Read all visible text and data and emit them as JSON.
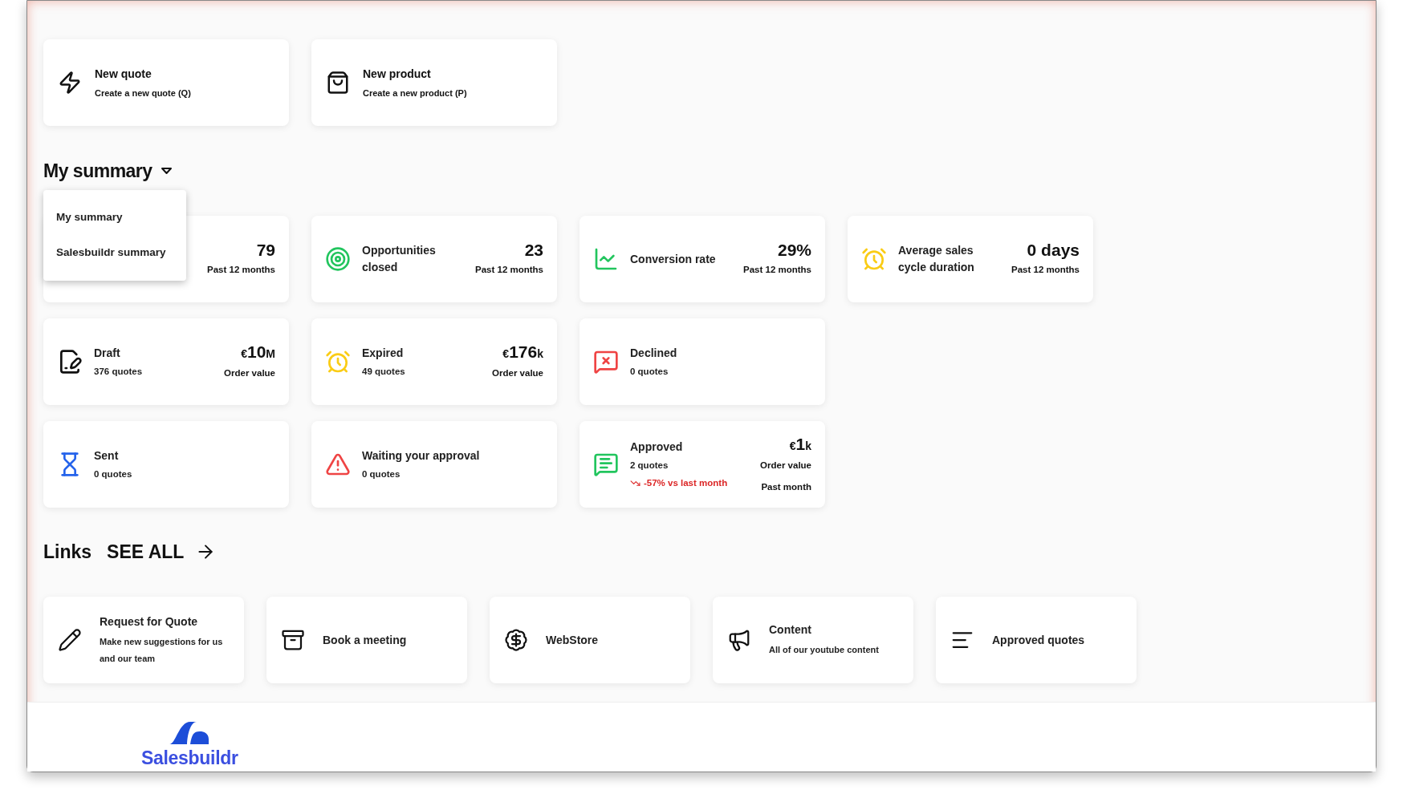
{
  "quick_actions": [
    {
      "title": "New quote",
      "subtitle": "Create a new quote (Q)"
    },
    {
      "title": "New product",
      "subtitle": "Create a new product (P)"
    }
  ],
  "summary": {
    "title": "My summary",
    "menu": [
      "My summary",
      "Salesbuildr summary"
    ]
  },
  "stats_rows": [
    [
      {
        "value": "79",
        "caption": "Past 12 months"
      },
      {
        "title": "Opportunities closed",
        "value": "23",
        "caption": "Past 12 months"
      },
      {
        "title": "Conversion rate",
        "value": "29%",
        "caption": "Past 12 months"
      },
      {
        "title": "Average sales cycle duration",
        "value": "0 days",
        "caption": "Past 12 months"
      }
    ],
    [
      {
        "title": "Draft",
        "subtitle": "376 quotes",
        "currency": "€",
        "amount": "10",
        "unit": "M",
        "caption": "Order value"
      },
      {
        "title": "Expired",
        "subtitle": "49 quotes",
        "currency": "€",
        "amount": "176",
        "unit": "k",
        "caption": "Order value"
      },
      {
        "title": "Declined",
        "subtitle": "0 quotes"
      }
    ],
    [
      {
        "title": "Sent",
        "subtitle": "0 quotes"
      },
      {
        "title": "Waiting your approval",
        "subtitle": "0 quotes"
      },
      {
        "title": "Approved",
        "subtitle": "2 quotes",
        "trend": "-57% vs last month",
        "currency": "€",
        "amount": "1",
        "unit": "k",
        "caption": "Order value",
        "caption2": "Past month"
      }
    ]
  ],
  "links": {
    "title": "Links",
    "see_all": "SEE ALL",
    "items": [
      {
        "title": "Request for Quote",
        "subtitle": "Make new suggestions for us and our team"
      },
      {
        "title": "Book a meeting"
      },
      {
        "title": "WebStore"
      },
      {
        "title": "Content",
        "subtitle": "All of our youtube content"
      },
      {
        "title": "Approved quotes"
      }
    ]
  },
  "footer": {
    "logo_text": "Salesbuildr"
  }
}
